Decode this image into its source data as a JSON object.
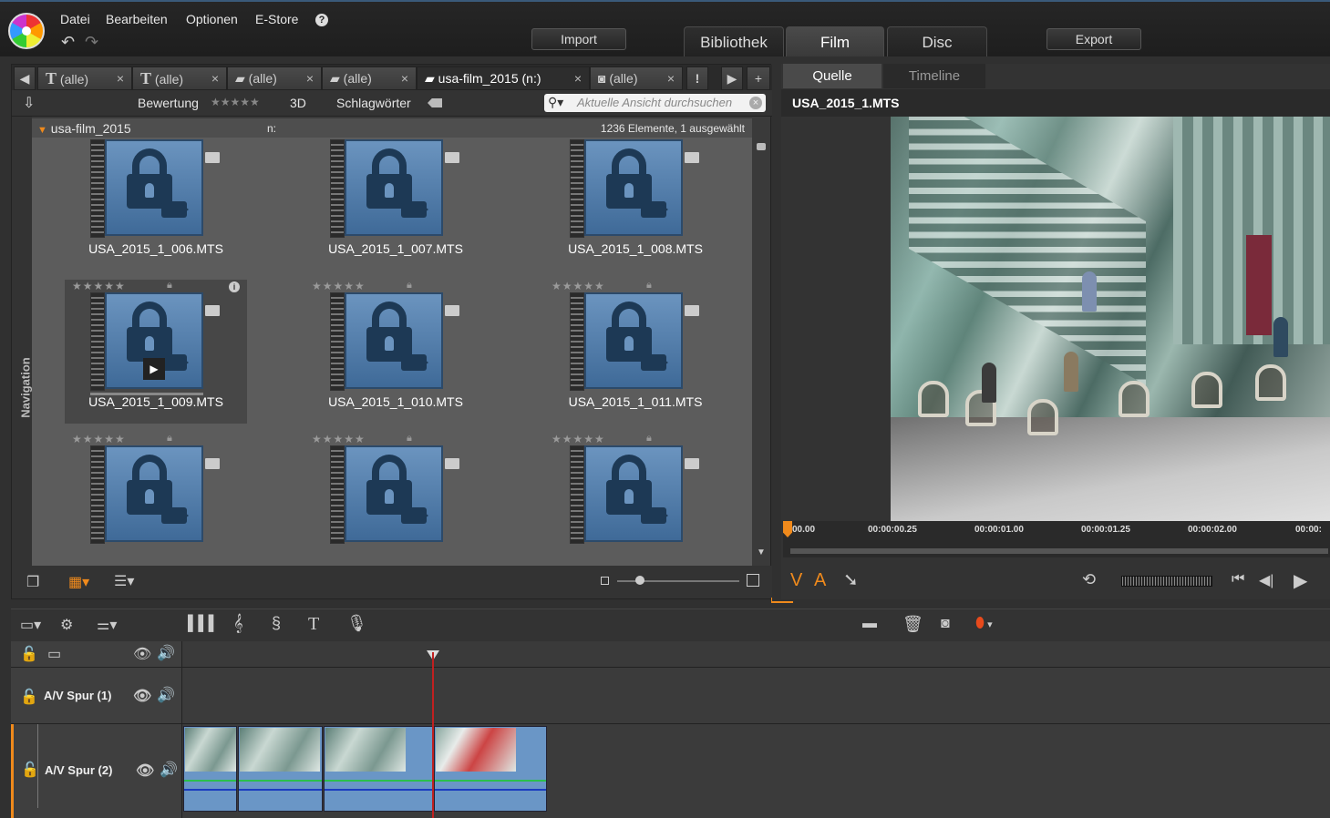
{
  "menu": {
    "datei": "Datei",
    "bearbeiten": "Bearbeiten",
    "optionen": "Optionen",
    "estore": "E-Store",
    "help": "?"
  },
  "buttons": {
    "import": "Import",
    "export": "Export"
  },
  "main_tabs": {
    "bibliothek": "Bibliothek",
    "film": "Film",
    "disc": "Disc"
  },
  "lib_tabs": [
    {
      "label": "(alle)",
      "icon": "T"
    },
    {
      "label": "(alle)",
      "icon": "T"
    },
    {
      "label": "(alle)",
      "icon": "camera"
    },
    {
      "label": "(alle)",
      "icon": "camera"
    },
    {
      "label": "usa-film_2015 (n:)",
      "icon": "camera"
    },
    {
      "label": "(alle)",
      "icon": "photo"
    }
  ],
  "libbar": {
    "rating": "Bewertung",
    "stars": "★★★★★",
    "three_d": "3D",
    "keywords": "Schlagwörter",
    "search_placeholder": "Aktuelle Ansicht durchsuchen"
  },
  "libhead": {
    "folder": "usa-film_2015",
    "drive": "n:",
    "count": "1236 Elemente, 1 ausgewählt"
  },
  "navigation": "Navigation",
  "items": [
    {
      "name": "USA_2015_1_006.MTS"
    },
    {
      "name": "USA_2015_1_007.MTS"
    },
    {
      "name": "USA_2015_1_008.MTS"
    },
    {
      "name": "USA_2015_1_009.MTS",
      "selected": true
    },
    {
      "name": "USA_2015_1_010.MTS"
    },
    {
      "name": "USA_2015_1_011.MTS"
    },
    {
      "name": ""
    },
    {
      "name": ""
    },
    {
      "name": ""
    }
  ],
  "item_stars": "★★★★★",
  "preview": {
    "tab_source": "Quelle",
    "tab_timeline": "Timeline",
    "filename": "USA_2015_1.MTS",
    "ruler": [
      "00.00",
      "00:00:00.25",
      "00:00:01.00",
      "00:00:01.25",
      "00:00:02.00",
      "00:00:"
    ],
    "v": "V",
    "a": "A"
  },
  "tracks": [
    {
      "name": "A/V Spur (1)"
    },
    {
      "name": "A/V Spur (2)"
    }
  ],
  "colors": {
    "accent": "#f08a1c",
    "clip": "#6a96c6",
    "playhead": "#c02020"
  }
}
